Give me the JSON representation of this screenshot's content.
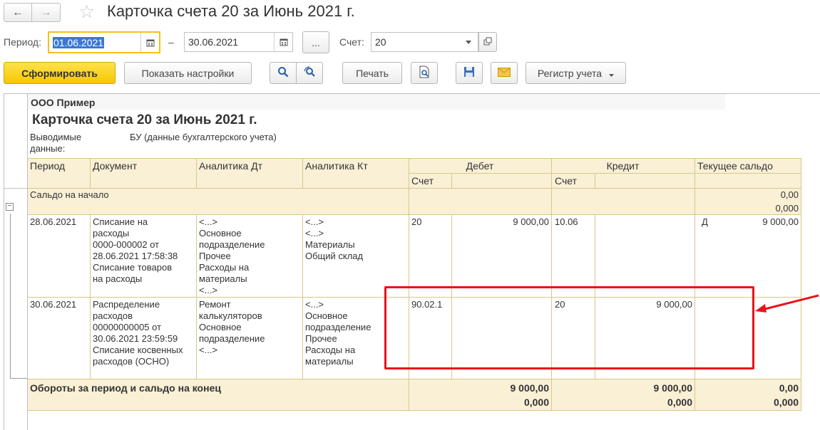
{
  "window": {
    "title": "Карточка счета 20 за Июнь 2021 г.",
    "back_icon": "←",
    "forward_icon": "→",
    "star_icon": "☆"
  },
  "filters": {
    "period_label": "Период:",
    "date_from": "01.06.2021",
    "dash": "–",
    "date_to": "30.06.2021",
    "period_picker": "...",
    "account_label": "Счет:",
    "account_value": "20"
  },
  "toolbar": {
    "generate": "Сформировать",
    "show_settings": "Показать настройки",
    "print": "Печать",
    "register": "Регистр учета"
  },
  "report": {
    "company": "ООО Пример",
    "title": "Карточка счета 20 за Июнь 2021 г.",
    "output_label": "Выводимые\nданные:",
    "output_value": "БУ (данные бухгалтерского учета)",
    "headers": {
      "period": "Период",
      "document": "Документ",
      "analytics_dt": "Аналитика Дт",
      "analytics_kt": "Аналитика Кт",
      "debit": "Дебет",
      "credit": "Кредит",
      "balance": "Текущее сальдо",
      "debit_account": "Счет",
      "credit_account": "Счет"
    },
    "opening": {
      "label": "Сальдо на начало",
      "amount": "0,00",
      "qty": "0,000"
    },
    "rows": [
      {
        "period": "28.06.2021",
        "document": "Списание на\nрасходы\n0000-000002 от\n28.06.2021 17:58:38\nСписание товаров\nна расходы",
        "analytics_dt": "<...>\nОсновное\nподразделение\nПрочее\nРасходы на\nматериалы\n<...>",
        "analytics_kt": "<...>\n<...>\nМатериалы\nОбщий склад",
        "debit_account": "20",
        "debit_amount": "9 000,00",
        "credit_account": "10.06",
        "credit_amount": "",
        "balance_side": "Д",
        "balance_amount": "9 000,00"
      },
      {
        "period": "30.06.2021",
        "document": "Распределение\nрасходов\n00000000005 от\n30.06.2021 23:59:59\nСписание косвенных\nрасходов (ОСНО)",
        "analytics_dt": "Ремонт\nкалькуляторов\nОсновное\nподразделение\n<...>",
        "analytics_kt": "<...>\nОсновное\nподразделение\nПрочее\nРасходы на\nматериалы",
        "debit_account": "90.02.1",
        "debit_amount": "",
        "credit_account": "20",
        "credit_amount": "9 000,00",
        "balance_side": "",
        "balance_amount": ""
      }
    ],
    "totals": {
      "label": "Обороты за период и сальдо на конец",
      "debit_amount": "9 000,00",
      "debit_qty": "0,000",
      "credit_amount": "9 000,00",
      "credit_qty": "0,000",
      "balance_amount": "0,00",
      "balance_qty": "0,000"
    }
  },
  "colors": {
    "header_bg": "#f9f0d6",
    "grid": "#d6c88a",
    "highlight": "#e8131b",
    "accent_button": "#f5c800"
  }
}
